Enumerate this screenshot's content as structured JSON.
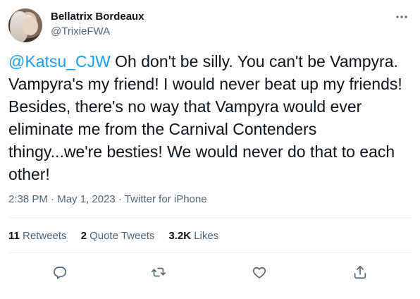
{
  "user": {
    "display_name": "Bellatrix Bordeaux",
    "handle": "@TrixieFWA"
  },
  "tweet": {
    "mention": "@Katsu_CJW",
    "text": " Oh don't be silly. You can't be Vampyra. Vampyra's my friend! I would never beat up my friends! Besides, there's no way that Vampyra would ever eliminate me from the Carnival Contenders thingy...we're besties! We would never do that to each other!",
    "time": "2:38 PM",
    "separator1": " · ",
    "date": "May 1, 2023",
    "separator2": " · ",
    "source": "Twitter for iPhone"
  },
  "stats": {
    "retweets_count": "11",
    "retweets_label": "Retweets",
    "quotes_count": "2",
    "quotes_label": "Quote Tweets",
    "likes_count": "3.2K",
    "likes_label": "Likes"
  },
  "icons": {
    "more": "more-options-icon",
    "reply": "reply-icon",
    "retweet": "retweet-icon",
    "like": "heart-icon",
    "share": "share-icon"
  },
  "colors": {
    "accent": "#1d9bf0",
    "text": "#0f1419",
    "secondary": "#536471",
    "divider": "#eff3f4"
  }
}
